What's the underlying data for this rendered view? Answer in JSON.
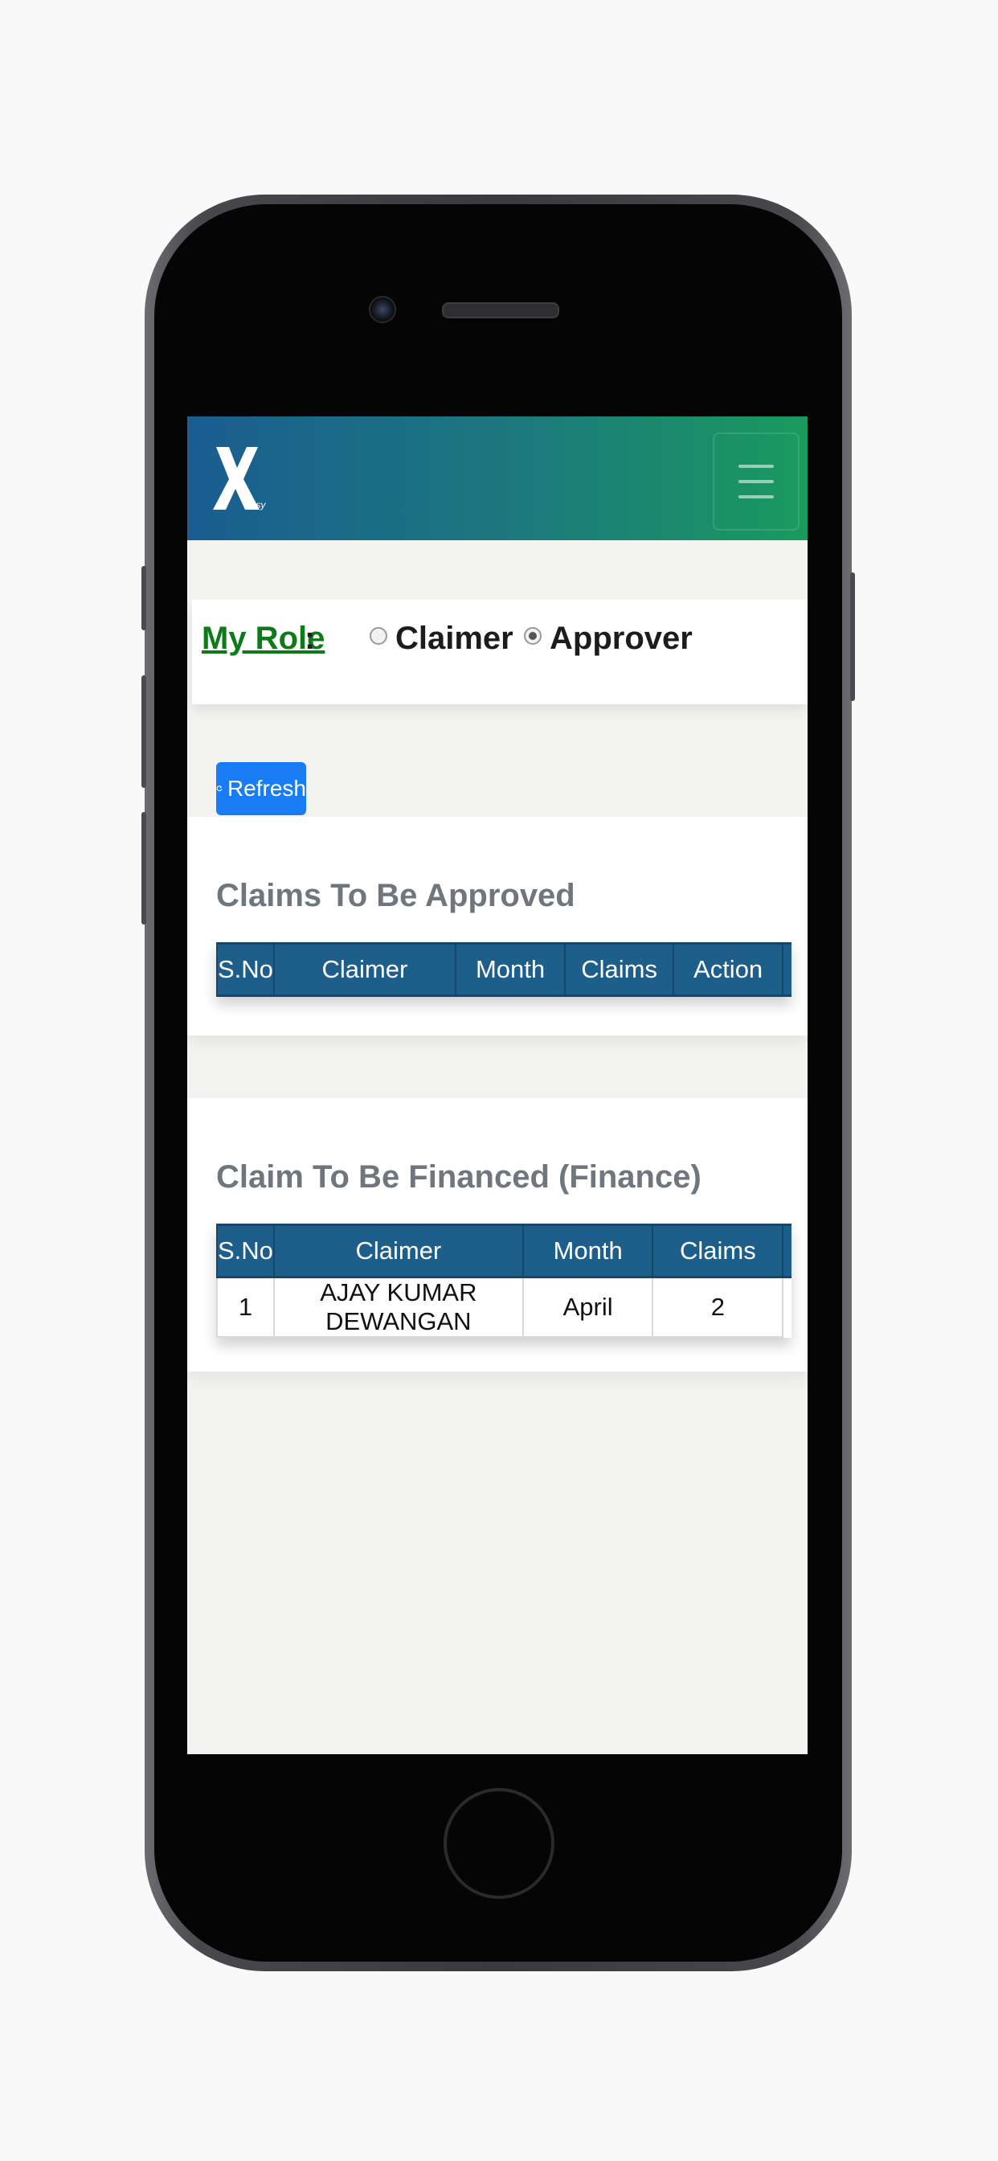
{
  "app": {
    "logo_text": "X",
    "logo_subtext": "easy"
  },
  "role": {
    "label": "My Role",
    "colon": ":",
    "options": [
      {
        "label": "Claimer",
        "selected": false
      },
      {
        "label": "Approver",
        "selected": true
      }
    ]
  },
  "refresh_button": {
    "icon": "refresh-icon",
    "label": "Refresh"
  },
  "approve_section": {
    "title": "Claims To Be Approved",
    "columns": [
      "S.No",
      "Claimer",
      "Month",
      "Claims",
      "Action"
    ],
    "rows": []
  },
  "finance_section": {
    "title": "Claim To Be Financed (Finance)",
    "columns": [
      "S.No",
      "Claimer",
      "Month",
      "Claims"
    ],
    "rows": [
      {
        "sno": "1",
        "claimer": "AJAY KUMAR DEWANGAN",
        "month": "April",
        "claims": "2"
      }
    ]
  },
  "colors": {
    "navbar_start": "#1a5d91",
    "navbar_end": "#1a9a5e",
    "table_header": "#1d5f8a",
    "role_label": "#0f7a1a",
    "link": "#1a7cf5",
    "button": "#1a7cf5"
  }
}
